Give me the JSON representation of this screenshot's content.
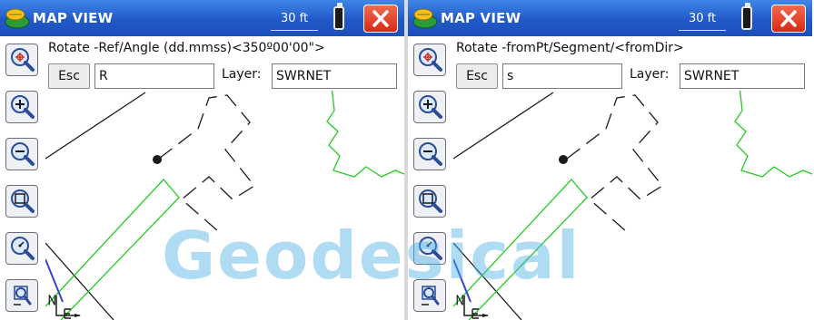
{
  "panels": [
    {
      "title": "MAP VIEW",
      "scale": "30 ft",
      "prompt": "Rotate  -Ref/Angle (dd.mmss)<350º00'00\">",
      "esc_label": "Esc",
      "command_value": "R",
      "layer_label": "Layer:",
      "layer_value": "SWRNET"
    },
    {
      "title": "MAP VIEW",
      "scale": "30 ft",
      "prompt": "Rotate  -fromPt/Segment/<fromDir>",
      "esc_label": "Esc",
      "command_value": "s",
      "layer_label": "Layer:",
      "layer_value": "SWRNET"
    }
  ],
  "toolbar_icons": [
    "zoom-extents-icon",
    "zoom-in-icon",
    "zoom-out-icon",
    "zoom-window-icon",
    "zoom-previous-icon",
    "pan-icon"
  ],
  "watermark": "Geodesical",
  "colors": {
    "titlebar": "#2158c8",
    "close_button": "#d82a14",
    "linework_green": "#22cc22",
    "linework_black": "#1a1a1a",
    "north_arrow_line": "#3344cc",
    "watermark": "#4fb1e6"
  }
}
